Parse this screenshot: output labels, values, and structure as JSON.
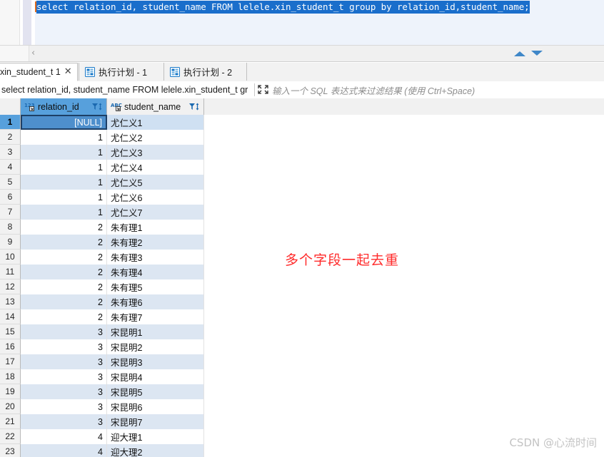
{
  "editor": {
    "sql_text": "select relation_id, student_name  FROM lelele.xin_student_t group by relation_id,student_name;",
    "selection_color": "#1a6ecb",
    "caret_color": "#e06c1f"
  },
  "tabs": [
    {
      "label": "xin_student_t 1",
      "icon": "grid-icon",
      "close": "✕",
      "active": true
    },
    {
      "label": "执行计划 - 1",
      "icon": "plan-icon",
      "active": false
    },
    {
      "label": "执行计划 - 2",
      "icon": "plan-icon",
      "active": false
    }
  ],
  "filterbar": {
    "query": "select relation_id, student_name FROM lelele.xin_student_t gr",
    "expand_icon": "expand-arrows-icon",
    "placeholder": "输入一个 SQL 表达式来过滤结果 (使用 Ctrl+Space)"
  },
  "grid": {
    "columns": [
      {
        "name": "relation_id",
        "type_icon": "numeric-123-icon",
        "selected": true
      },
      {
        "name": "student_name",
        "type_icon": "text-abc-icon",
        "selected": false
      }
    ],
    "selected_cell": {
      "row": 1,
      "column": "relation_id",
      "value": "[NULL]"
    },
    "rows": [
      {
        "n": "1",
        "relation_id": "[NULL]",
        "student_name": "尤仁义1"
      },
      {
        "n": "2",
        "relation_id": "1",
        "student_name": "尤仁义2"
      },
      {
        "n": "3",
        "relation_id": "1",
        "student_name": "尤仁义3"
      },
      {
        "n": "4",
        "relation_id": "1",
        "student_name": "尤仁义4"
      },
      {
        "n": "5",
        "relation_id": "1",
        "student_name": "尤仁义5"
      },
      {
        "n": "6",
        "relation_id": "1",
        "student_name": "尤仁义6"
      },
      {
        "n": "7",
        "relation_id": "1",
        "student_name": "尤仁义7"
      },
      {
        "n": "8",
        "relation_id": "2",
        "student_name": "朱有理1"
      },
      {
        "n": "9",
        "relation_id": "2",
        "student_name": "朱有理2"
      },
      {
        "n": "10",
        "relation_id": "2",
        "student_name": "朱有理3"
      },
      {
        "n": "11",
        "relation_id": "2",
        "student_name": "朱有理4"
      },
      {
        "n": "12",
        "relation_id": "2",
        "student_name": "朱有理5"
      },
      {
        "n": "13",
        "relation_id": "2",
        "student_name": "朱有理6"
      },
      {
        "n": "14",
        "relation_id": "2",
        "student_name": "朱有理7"
      },
      {
        "n": "15",
        "relation_id": "3",
        "student_name": "宋昆明1"
      },
      {
        "n": "16",
        "relation_id": "3",
        "student_name": "宋昆明2"
      },
      {
        "n": "17",
        "relation_id": "3",
        "student_name": "宋昆明3"
      },
      {
        "n": "18",
        "relation_id": "3",
        "student_name": "宋昆明4"
      },
      {
        "n": "19",
        "relation_id": "3",
        "student_name": "宋昆明5"
      },
      {
        "n": "20",
        "relation_id": "3",
        "student_name": "宋昆明6"
      },
      {
        "n": "21",
        "relation_id": "3",
        "student_name": "宋昆明7"
      },
      {
        "n": "22",
        "relation_id": "4",
        "student_name": "迎大理1"
      },
      {
        "n": "23",
        "relation_id": "4",
        "student_name": "迎大理2"
      }
    ]
  },
  "annotation": {
    "text": "多个字段一起去重",
    "color": "#ff2a2a"
  },
  "watermark": {
    "text": "CSDN @心流时间"
  },
  "scroll_controls": {
    "chevron_left": "‹",
    "up_triangle": "triangle-up-icon",
    "down_triangle": "triangle-down-icon"
  }
}
